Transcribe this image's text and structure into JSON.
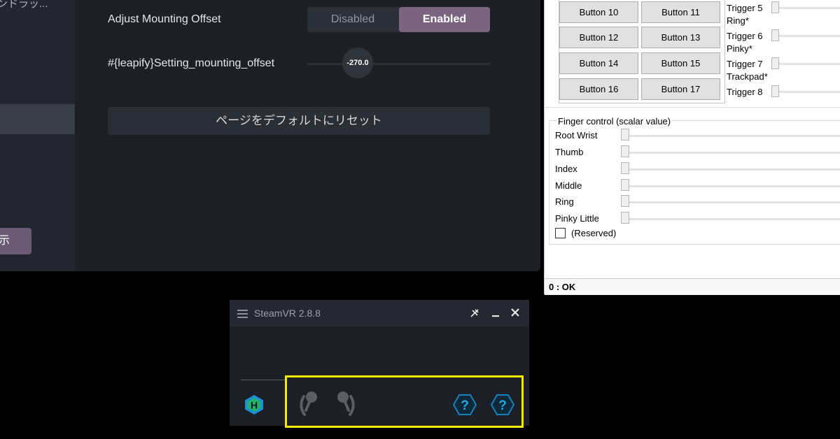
{
  "settings": {
    "sidebar_top_text": "ンドラッ...",
    "sidebar_show_button": "示",
    "mounting_offset_label": "Adjust Mounting Offset",
    "seg_disabled": "Disabled",
    "seg_enabled": "Enabled",
    "offset_setting_label": "#{leapify}Setting_mounting_offset",
    "offset_value": "-270.0",
    "reset_button": "ページをデフォルトにリセット",
    "accent_color": "#7a6480"
  },
  "controller": {
    "buttons": [
      "Button 10",
      "Button 11",
      "Button 12",
      "Button 13",
      "Button 14",
      "Button 15",
      "Button 16",
      "Button 17"
    ],
    "triggers": [
      {
        "name": "Trigger 5",
        "sub": "Ring*"
      },
      {
        "name": "Trigger 6",
        "sub": "Pinky*"
      },
      {
        "name": "Trigger 7",
        "sub": "Trackpad*"
      },
      {
        "name": "Trigger 8",
        "sub": ""
      }
    ],
    "finger_group_title": "Finger control (scalar value)",
    "fingers": [
      "Root Wrist",
      "Thumb",
      "Index",
      "Middle",
      "Ring",
      "Pinky Little"
    ],
    "reserved_label": "(Reserved)",
    "status": "0 : OK"
  },
  "steamvr": {
    "title": "SteamVR 2.8.8",
    "icons": [
      "menu-icon",
      "minimize-icon",
      "close-icon",
      "pin-icon",
      "headset-icon",
      "left-controller-icon",
      "right-controller-icon",
      "tracker-unknown-icon"
    ],
    "unknown_glyph": "?",
    "headset_glyph": "H",
    "highlight_color": "#f4ea00"
  }
}
